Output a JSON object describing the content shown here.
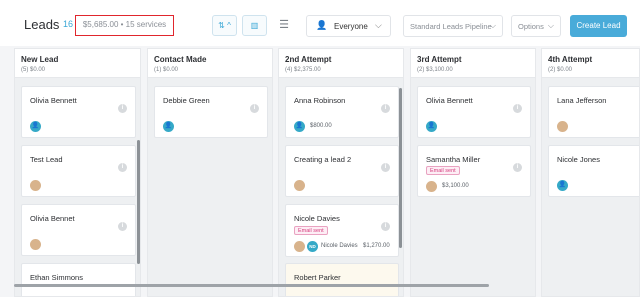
{
  "header": {
    "title": "Leads",
    "count": "16",
    "summary": "$5,685.00 • 15 services",
    "sort_glyph": "⇅ ^",
    "view_glyph": "▥",
    "menu_glyph": "☰",
    "owner_filter": "Everyone",
    "pipeline": "Standard Leads Pipeline",
    "options": "Options",
    "create_button": "Create Lead"
  },
  "colors": {
    "accent": "#49abd9",
    "avatar": "#35a9c7",
    "email_badge": "#d63b7d",
    "highlight_border": "#e0262d"
  },
  "columns": [
    {
      "title": "New Lead",
      "subtitle": "(5) $0.00",
      "cards": [
        {
          "name": "Olivia Bennett",
          "avatar": "user-icon"
        },
        {
          "name": "Test Lead",
          "avatar": "user-photo"
        },
        {
          "name": "Olivia Bennet",
          "avatar": "user-photo"
        },
        {
          "name": "Ethan Simmons"
        }
      ]
    },
    {
      "title": "Contact Made",
      "subtitle": "(1) $0.00",
      "cards": [
        {
          "name": "Debbie Green",
          "avatar": "user-icon"
        }
      ]
    },
    {
      "title": "2nd Attempt",
      "subtitle": "(4) $2,375.00",
      "cards": [
        {
          "name": "Anna Robinson",
          "avatar": "user-icon",
          "amount": "$800.00"
        },
        {
          "name": "Creating a lead 2",
          "avatar": "user-photo"
        },
        {
          "name": "Nicole Davies",
          "badge": "Email sent",
          "avatar_initials": "ND",
          "assignee": "Nicole Davies",
          "amount": "$1,270.00"
        },
        {
          "name": "Robert Parker"
        }
      ]
    },
    {
      "title": "3rd Attempt",
      "subtitle": "(2) $3,100.00",
      "cards": [
        {
          "name": "Olivia Bennett",
          "avatar": "user-icon"
        },
        {
          "name": "Samantha Miller",
          "badge": "Email sent",
          "avatar": "user-photo",
          "amount": "$3,100.00"
        }
      ]
    },
    {
      "title": "4th Attempt",
      "subtitle": "(2) $0.00",
      "cards": [
        {
          "name": "Lana Jefferson",
          "avatar": "user-photo"
        },
        {
          "name": "Nicole Jones",
          "avatar": "user-icon"
        }
      ]
    }
  ],
  "info_glyph": "i",
  "user_glyph": "👤",
  "owner_glyph": "👤",
  "chevron_glyph": "⌵"
}
